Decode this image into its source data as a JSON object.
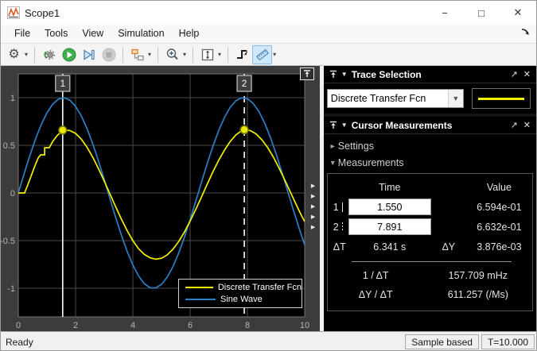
{
  "window": {
    "title": "Scope1",
    "controls": {
      "minimize": "−",
      "maximize": "□",
      "close": "✕"
    }
  },
  "menu": {
    "items": [
      "File",
      "Tools",
      "View",
      "Simulation",
      "Help"
    ]
  },
  "toolbar": {
    "buttons": [
      "configuration",
      "stepping-options",
      "run",
      "step-forward",
      "stop",
      "simulink-snapshot",
      "zoom",
      "fit-to-view",
      "trigger",
      "cursor-measurements"
    ]
  },
  "chart_data": {
    "type": "line",
    "title": "",
    "xlabel": "",
    "ylabel": "",
    "xlim": [
      0,
      10
    ],
    "ylim": [
      -1.3,
      1.25
    ],
    "x_ticks": [
      "0",
      "2",
      "4",
      "6",
      "8",
      "10"
    ],
    "x_tick_vals": [
      0,
      2,
      4,
      6,
      8,
      10
    ],
    "y_ticks": [
      "1",
      "0.5",
      "0",
      "-0.5",
      "-1"
    ],
    "y_tick_vals": [
      1,
      0.5,
      0,
      -0.5,
      -1
    ],
    "grid": true,
    "legend_position": "lower right",
    "series": [
      {
        "name": "Discrete Transfer Fcn",
        "color": "#f2f200",
        "points": [
          [
            0,
            0
          ],
          [
            0.22,
            0
          ],
          [
            0.35,
            0.1
          ],
          [
            0.5,
            0.22
          ],
          [
            0.6,
            0.3
          ],
          [
            0.7,
            0.37
          ],
          [
            0.78,
            0.4
          ],
          [
            0.92,
            0.4
          ],
          [
            0.92,
            0.475
          ],
          [
            1.08,
            0.475
          ],
          [
            1.2,
            0.54
          ],
          [
            1.35,
            0.6
          ],
          [
            1.5,
            0.645
          ],
          [
            1.65,
            0.662
          ],
          [
            1.8,
            0.655
          ],
          [
            2,
            0.625
          ],
          [
            2.2,
            0.565
          ],
          [
            2.4,
            0.48
          ],
          [
            2.6,
            0.375
          ],
          [
            2.8,
            0.255
          ],
          [
            3,
            0.125
          ],
          [
            3.2,
            -0.01
          ],
          [
            3.4,
            -0.145
          ],
          [
            3.6,
            -0.275
          ],
          [
            3.8,
            -0.395
          ],
          [
            4,
            -0.5
          ],
          [
            4.2,
            -0.585
          ],
          [
            4.4,
            -0.645
          ],
          [
            4.6,
            -0.68
          ],
          [
            4.8,
            -0.695
          ],
          [
            5,
            -0.685
          ],
          [
            5.2,
            -0.65
          ],
          [
            5.4,
            -0.59
          ],
          [
            5.6,
            -0.51
          ],
          [
            5.8,
            -0.41
          ],
          [
            6,
            -0.295
          ],
          [
            6.2,
            -0.17
          ],
          [
            6.4,
            -0.04
          ],
          [
            6.6,
            0.095
          ],
          [
            6.8,
            0.225
          ],
          [
            7,
            0.345
          ],
          [
            7.2,
            0.45
          ],
          [
            7.4,
            0.54
          ],
          [
            7.6,
            0.61
          ],
          [
            7.8,
            0.653
          ],
          [
            7.9,
            0.663
          ],
          [
            8.1,
            0.655
          ],
          [
            8.3,
            0.62
          ],
          [
            8.5,
            0.56
          ],
          [
            8.7,
            0.48
          ],
          [
            8.9,
            0.38
          ],
          [
            9.1,
            0.265
          ],
          [
            9.3,
            0.14
          ],
          [
            9.5,
            0.01
          ],
          [
            9.7,
            -0.12
          ],
          [
            9.9,
            -0.245
          ],
          [
            10,
            -0.3
          ]
        ]
      },
      {
        "name": "Sine Wave",
        "color": "#2b80c6",
        "points": [
          [
            0,
            0
          ],
          [
            0.2,
            0.199
          ],
          [
            0.4,
            0.389
          ],
          [
            0.6,
            0.565
          ],
          [
            0.8,
            0.717
          ],
          [
            1,
            0.841
          ],
          [
            1.2,
            0.932
          ],
          [
            1.4,
            0.985
          ],
          [
            1.6,
            1.0
          ],
          [
            1.8,
            0.974
          ],
          [
            2,
            0.909
          ],
          [
            2.2,
            0.808
          ],
          [
            2.4,
            0.675
          ],
          [
            2.6,
            0.516
          ],
          [
            2.8,
            0.335
          ],
          [
            3,
            0.141
          ],
          [
            3.2,
            -0.058
          ],
          [
            3.4,
            -0.256
          ],
          [
            3.6,
            -0.443
          ],
          [
            3.8,
            -0.612
          ],
          [
            4,
            -0.757
          ],
          [
            4.2,
            -0.872
          ],
          [
            4.4,
            -0.952
          ],
          [
            4.6,
            -0.994
          ],
          [
            4.8,
            -0.996
          ],
          [
            5,
            -0.959
          ],
          [
            5.2,
            -0.883
          ],
          [
            5.4,
            -0.773
          ],
          [
            5.6,
            -0.631
          ],
          [
            5.8,
            -0.465
          ],
          [
            6,
            -0.279
          ],
          [
            6.2,
            -0.083
          ],
          [
            6.4,
            0.117
          ],
          [
            6.6,
            0.312
          ],
          [
            6.8,
            0.494
          ],
          [
            7,
            0.657
          ],
          [
            7.2,
            0.794
          ],
          [
            7.4,
            0.899
          ],
          [
            7.6,
            0.968
          ],
          [
            7.8,
            0.999
          ],
          [
            8,
            0.989
          ],
          [
            8.2,
            0.94
          ],
          [
            8.4,
            0.855
          ],
          [
            8.6,
            0.734
          ],
          [
            8.8,
            0.585
          ],
          [
            9,
            0.412
          ],
          [
            9.2,
            0.223
          ],
          [
            9.4,
            0.025
          ],
          [
            9.6,
            -0.174
          ],
          [
            9.8,
            -0.366
          ],
          [
            10,
            -0.544
          ]
        ]
      }
    ],
    "cursors": [
      {
        "label": "1",
        "time": 1.55,
        "value": 0.6594,
        "line": "solid"
      },
      {
        "label": "2",
        "time": 7.891,
        "value": 0.6632,
        "line": "dashed"
      }
    ],
    "colors": {
      "plot_bg": "#000000",
      "figure_bg": "#3c3c3c",
      "grid": "#4d4d4d",
      "axes_border": "#767676",
      "tick_label": "#b4b4b4",
      "cursor": "#ffffff",
      "marker_fill": "#e8e800",
      "marker_stroke": "#6f6f00"
    }
  },
  "trace_selection": {
    "title": "Trace Selection",
    "selected_trace": "Discrete Transfer Fcn",
    "sample_color": "#f2f200"
  },
  "cursor_measurements": {
    "title": "Cursor Measurements",
    "settings_label": "Settings",
    "measurements_label": "Measurements",
    "table": {
      "time_header": "Time",
      "value_header": "Value",
      "row1": {
        "label": "1",
        "time": "1.550",
        "value": "6.594e-01"
      },
      "row2": {
        "label": "2",
        "time": "7.891",
        "value": "6.632e-01"
      },
      "delta_t_label": "ΔT",
      "delta_t": "6.341 s",
      "delta_y_label": "ΔY",
      "delta_y": "3.876e-03",
      "inv_dt_label": "1 / ΔT",
      "inv_dt": "157.709 mHz",
      "slope_label": "ΔY / ΔT",
      "slope": "611.257 (/Ms)"
    }
  },
  "statusbar": {
    "status": "Ready",
    "sample_mode": "Sample based",
    "sim_time": "T=10.000"
  }
}
